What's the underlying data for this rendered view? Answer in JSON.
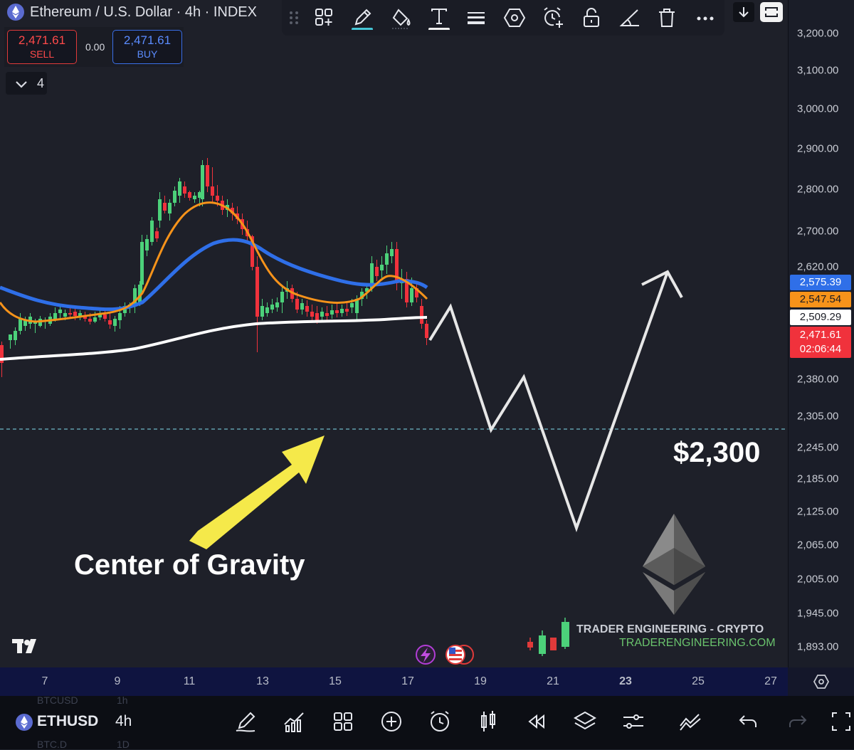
{
  "header": {
    "title": "Ethereum / U.S. Dollar · 4h · INDEX"
  },
  "trade": {
    "sell_price": "2,471.61",
    "sell_label": "SELL",
    "spread": "0.00",
    "buy_price": "2,471.61",
    "buy_label": "BUY"
  },
  "indicators_toggle": {
    "count": "4"
  },
  "toolbar": {
    "icons": [
      "grid-add-icon",
      "pencil-icon",
      "fill-bucket-icon",
      "text-tool-icon",
      "line-weight-icon",
      "hexagon-icon",
      "alarm-add-icon",
      "lock-icon",
      "angle-icon",
      "trash-icon",
      "more-icon"
    ]
  },
  "price_axis": {
    "labels": [
      "3,200.00",
      "3,100.00",
      "3,000.00",
      "2,900.00",
      "2,800.00",
      "2,700.00",
      "2,620.00",
      "2,380.00",
      "2,305.00",
      "2,245.00",
      "2,185.00",
      "2,125.00",
      "2,065.00",
      "2,005.00",
      "1,945.00",
      "1,893.00"
    ],
    "tags": {
      "blue": "2,575.39",
      "orange": "2,547.54",
      "white": "2,509.29",
      "current": "2,471.61",
      "countdown": "02:06:44"
    }
  },
  "time_axis": {
    "labels": [
      "7",
      "9",
      "11",
      "13",
      "15",
      "17",
      "19",
      "21",
      "23",
      "25",
      "27"
    ]
  },
  "annotations": {
    "target": "$2,300",
    "center": "Center of Gravity"
  },
  "branding": {
    "name": "TRADER ENGINEERING - CRYPTO",
    "url": "TRADERENGINEERING.COM"
  },
  "bottom_bar": {
    "symbol": "ETHUSD",
    "interval": "4h",
    "ghost_top_symbol": "BTCUSD",
    "ghost_top_interval": "1h",
    "ghost_bottom_symbol": "BTC.D",
    "ghost_bottom_interval": "1D",
    "icons": [
      "draw-icon",
      "indicators-icon",
      "grid-icon",
      "add-icon",
      "alert-icon",
      "candles-icon",
      "replay-icon",
      "layers-icon",
      "settings-sliders-icon",
      "compare-icon",
      "undo-icon",
      "redo-icon",
      "fullscreen-icon"
    ]
  },
  "colors": {
    "background": "#1e2029",
    "up_candle": "#4cd17a",
    "down_candle": "#f0323c",
    "ema_fast": "#f7931a",
    "ema_mid": "#2f6fe8",
    "ma_slow": "#ffffff",
    "arrow": "#f5e94a",
    "target_line": "#6fb8c8"
  }
}
